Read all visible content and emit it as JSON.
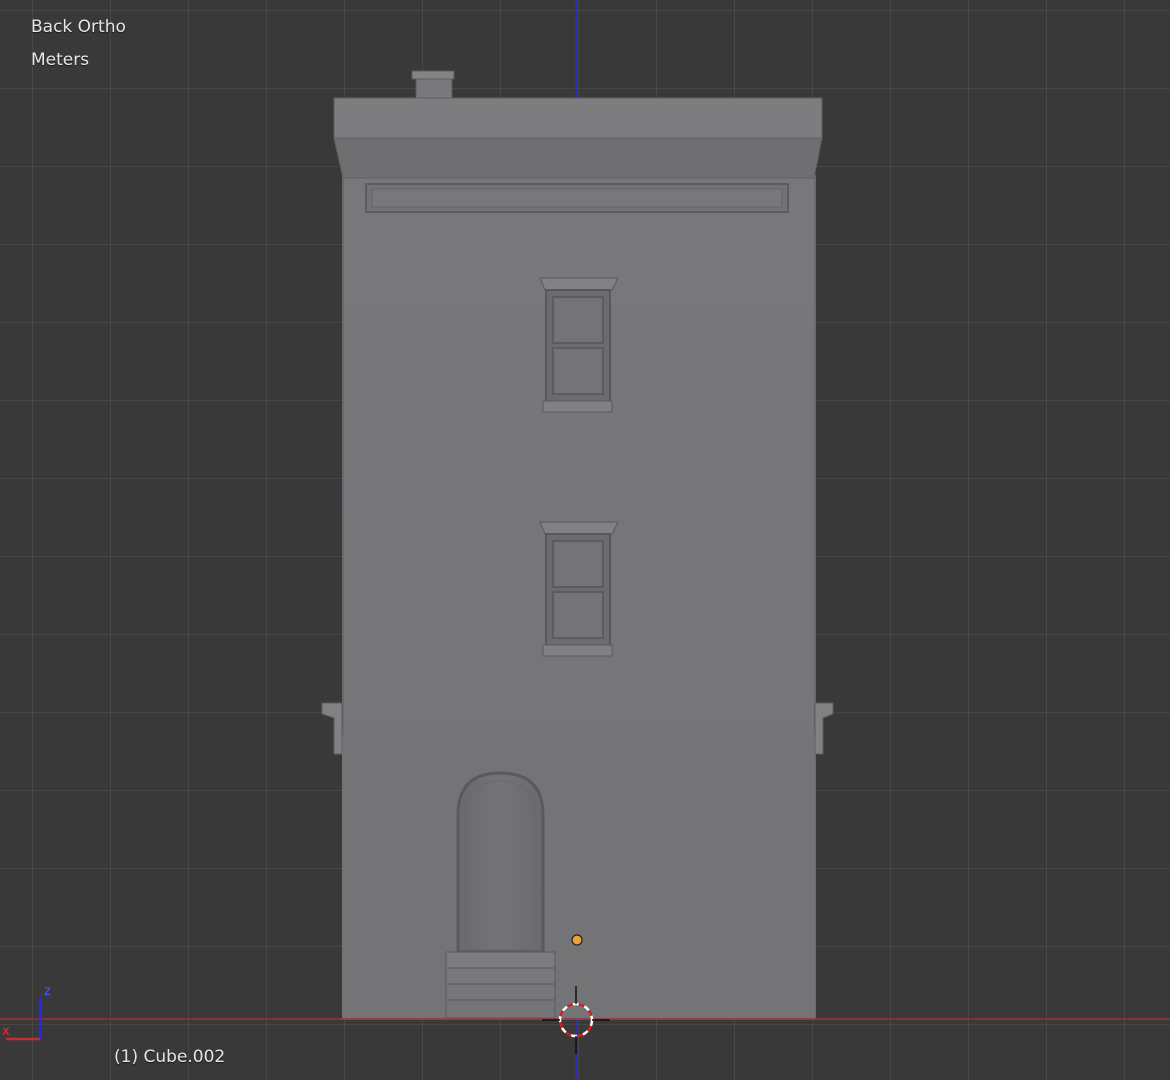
{
  "viewport": {
    "view_name": "Back Ortho",
    "units": "Meters",
    "object_info": "(1) Cube.002"
  },
  "axes": {
    "vertical_axis_label": "z",
    "horizontal_axis_label": "x",
    "x_axis_color": "#b03030",
    "z_axis_color": "#2a2ad6"
  },
  "colors": {
    "background": "#393939",
    "building": "#777779",
    "cursor_red": "#d02020",
    "origin_dot": "#f0a040"
  },
  "icons": {
    "cursor": "3d-cursor-icon",
    "origin": "object-origin-icon",
    "axis_gizmo": "axis-gizmo-icon"
  }
}
